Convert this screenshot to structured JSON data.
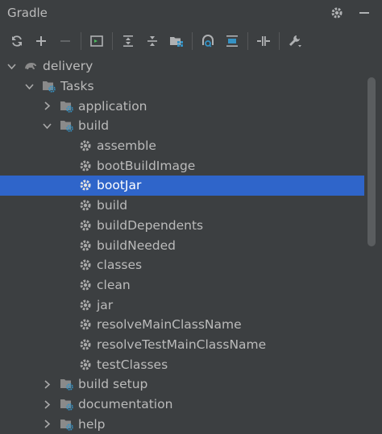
{
  "header": {
    "title": "Gradle",
    "settings_icon": "gear-icon",
    "hide_icon": "minus-icon"
  },
  "toolbar": [
    {
      "name": "refresh-button",
      "icon": "refresh-icon"
    },
    {
      "name": "add-button",
      "icon": "plus-icon"
    },
    {
      "name": "remove-button",
      "icon": "minus-icon"
    },
    {
      "name": "execute-task-button",
      "icon": "terminal-icon"
    },
    {
      "name": "expand-all-button",
      "icon": "expand-icon"
    },
    {
      "name": "collapse-all-button",
      "icon": "collapse-icon"
    },
    {
      "name": "group-modules-button",
      "icon": "folder-grid-icon"
    },
    {
      "name": "analyze-dependencies-button",
      "icon": "dependencies-icon"
    },
    {
      "name": "show-dependencies-button",
      "icon": "split-icon"
    },
    {
      "name": "toggle-offline-button",
      "icon": "offline-icon"
    },
    {
      "name": "build-settings-button",
      "icon": "wrench-icon"
    }
  ],
  "tree": {
    "project": "delivery",
    "tasks_group": "Tasks",
    "groups": {
      "application": "application",
      "build": "build",
      "build_setup": "build setup",
      "documentation": "documentation",
      "help": "help"
    },
    "build_tasks": [
      "assemble",
      "bootBuildImage",
      "bootJar",
      "build",
      "buildDependents",
      "buildNeeded",
      "classes",
      "clean",
      "jar",
      "resolveMainClassName",
      "resolveTestMainClassName",
      "testClasses"
    ],
    "selected": "bootJar"
  },
  "colors": {
    "background": "#3c3f41",
    "selection": "#2f65ca",
    "text": "#bbbbbb",
    "accent_blue": "#3592c4"
  }
}
